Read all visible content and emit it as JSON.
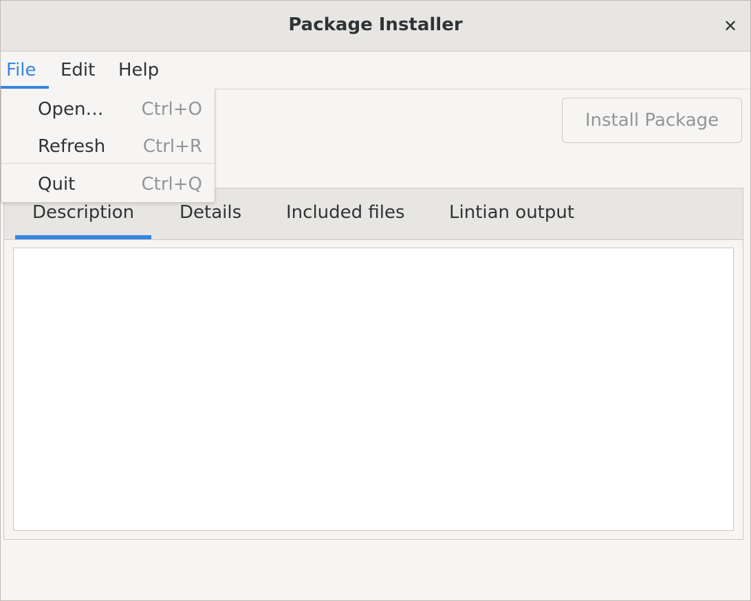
{
  "window": {
    "title": "Package Installer",
    "close_glyph": "✕"
  },
  "menubar": {
    "items": [
      {
        "label": "File",
        "active": true
      },
      {
        "label": "Edit",
        "active": false
      },
      {
        "label": "Help",
        "active": false
      }
    ]
  },
  "file_menu": {
    "items": [
      {
        "label": "Open…",
        "accelerator": "Ctrl+O"
      },
      {
        "label": "Refresh",
        "accelerator": "Ctrl+R"
      },
      {
        "label": "Quit",
        "accelerator": "Ctrl+Q"
      }
    ]
  },
  "toolbar": {
    "install_label": "Install Package",
    "install_enabled": false
  },
  "tabs": {
    "items": [
      {
        "label": "Description",
        "selected": true
      },
      {
        "label": "Details",
        "selected": false
      },
      {
        "label": "Included files",
        "selected": false
      },
      {
        "label": "Lintian output",
        "selected": false
      }
    ]
  },
  "colors": {
    "accent": "#3584e4",
    "window_bg": "#f6f5f4",
    "header_bg": "#e8e6e3",
    "disabled_text": "#929595"
  },
  "icons": {
    "close": "close-icon"
  }
}
